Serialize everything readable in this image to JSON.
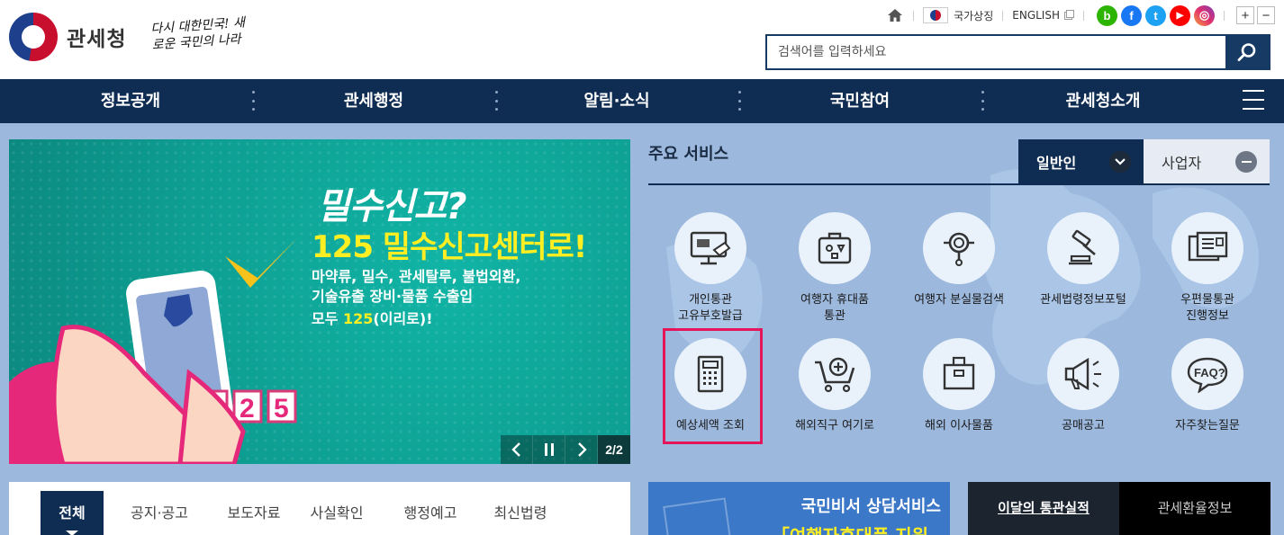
{
  "header": {
    "logo_text": "관세청",
    "slogan": "다시 대한민국! 새로운 국민의 나라",
    "util": {
      "national_symbol_label": "국가상징",
      "english_label": "ENGLISH",
      "sns": [
        {
          "name": "blog",
          "glyph": "b",
          "color": "#2db400"
        },
        {
          "name": "facebook",
          "glyph": "f",
          "color": "#1877f2"
        },
        {
          "name": "twitter",
          "glyph": "t",
          "color": "#1da1f2"
        },
        {
          "name": "youtube",
          "glyph": "▶",
          "color": "#ff0000"
        },
        {
          "name": "instagram",
          "glyph": "◎",
          "color": "#c13584"
        }
      ],
      "zoom_in": "+",
      "zoom_out": "−"
    },
    "search": {
      "placeholder": "검색어를 입력하세요"
    }
  },
  "gnb": {
    "items": [
      "정보공개",
      "관세행정",
      "알림·소식",
      "국민참여",
      "관세청소개"
    ]
  },
  "banner": {
    "line1": "밀수신고?",
    "line2": "125 밀수신고센터로!",
    "line3a": "마약류, 밀수, 관세탈루, 불법외환,",
    "line3b": "기술유출 장비·물품 수출입",
    "line4_prefix": "모두 ",
    "line4_highlight": "125",
    "line4_suffix": "(이리로)!",
    "phone_digits": [
      "1",
      "2",
      "5"
    ],
    "counter": "2/2"
  },
  "services": {
    "title": "주요 서비스",
    "tab_general": "일반인",
    "tab_business": "사업자",
    "items": [
      {
        "label1": "개인통관",
        "label2": "고유부호발급",
        "icon": "computer-card-icon"
      },
      {
        "label1": "여행자 휴대품",
        "label2": "통관",
        "icon": "suitcase-icon"
      },
      {
        "label1": "여행자 분실물검색",
        "label2": "",
        "icon": "magnifier-icon"
      },
      {
        "label1": "관세법령정보포털",
        "label2": "",
        "icon": "gavel-icon"
      },
      {
        "label1": "우편물통관",
        "label2": "진행정보",
        "icon": "mail-doc-icon"
      },
      {
        "label1": "예상세액 조회",
        "label2": "",
        "icon": "calculator-icon"
      },
      {
        "label1": "해외직구 여기로",
        "label2": "",
        "icon": "cart-icon"
      },
      {
        "label1": "해외 이사물품",
        "label2": "",
        "icon": "box-icon"
      },
      {
        "label1": "공매공고",
        "label2": "",
        "icon": "megaphone-icon"
      },
      {
        "label1": "자주찾는질문",
        "label2": "",
        "icon": "faq-icon"
      }
    ]
  },
  "notice": {
    "tabs": [
      "전체",
      "공지·공고",
      "보도자료",
      "사실확인",
      "행정예고",
      "최신법령"
    ]
  },
  "counsel": {
    "title": "국민비서 상담서비스",
    "subtitle": "「여행자휴대품 지원"
  },
  "stats_tab": "이달의 통관실적",
  "rate_tab": "관세환율정보"
}
